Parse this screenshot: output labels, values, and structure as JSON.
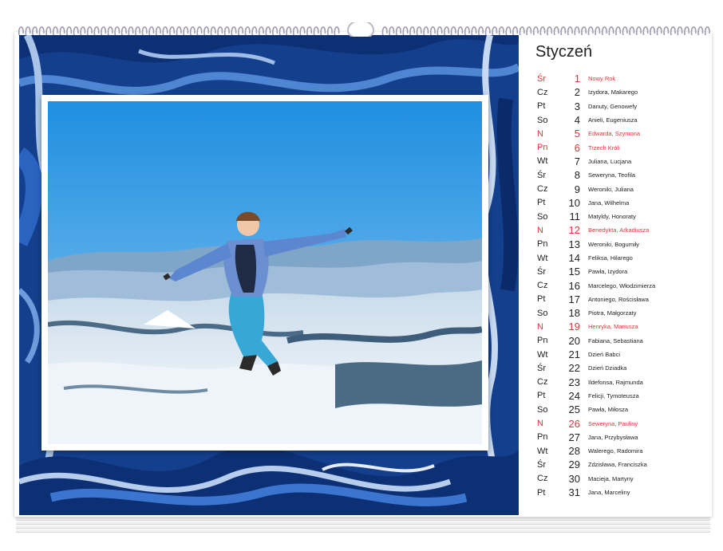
{
  "calendar": {
    "month": "Styczeń",
    "days": [
      {
        "abbr": "Śr",
        "num": "1",
        "names": "Nowy Rok",
        "holiday": true
      },
      {
        "abbr": "Cz",
        "num": "2",
        "names": "Izydora, Makarego",
        "holiday": false
      },
      {
        "abbr": "Pt",
        "num": "3",
        "names": "Danuty, Genowefy",
        "holiday": false
      },
      {
        "abbr": "So",
        "num": "4",
        "names": "Anieli, Eugeniusza",
        "holiday": false
      },
      {
        "abbr": "N",
        "num": "5",
        "names": "Edwarda, Szymona",
        "holiday": true
      },
      {
        "abbr": "Pn",
        "num": "6",
        "names": "Trzech Króli",
        "holiday": true
      },
      {
        "abbr": "Wt",
        "num": "7",
        "names": "Juliana, Lucjana",
        "holiday": false
      },
      {
        "abbr": "Śr",
        "num": "8",
        "names": "Seweryna, Teofila",
        "holiday": false
      },
      {
        "abbr": "Cz",
        "num": "9",
        "names": "Weroniki, Juliana",
        "holiday": false
      },
      {
        "abbr": "Pt",
        "num": "10",
        "names": "Jana, Wilhelma",
        "holiday": false
      },
      {
        "abbr": "So",
        "num": "11",
        "names": "Matyldy, Honoraty",
        "holiday": false
      },
      {
        "abbr": "N",
        "num": "12",
        "names": "Benedykta, Arkadiusza",
        "holiday": true
      },
      {
        "abbr": "Pn",
        "num": "13",
        "names": "Weroniki, Bogumiły",
        "holiday": false
      },
      {
        "abbr": "Wt",
        "num": "14",
        "names": "Feliksa, Hilarego",
        "holiday": false
      },
      {
        "abbr": "Śr",
        "num": "15",
        "names": "Pawła, Izydora",
        "holiday": false
      },
      {
        "abbr": "Cz",
        "num": "16",
        "names": "Marcelego, Włodzimierza",
        "holiday": false
      },
      {
        "abbr": "Pt",
        "num": "17",
        "names": "Antoniego, Rościsława",
        "holiday": false
      },
      {
        "abbr": "So",
        "num": "18",
        "names": "Piotra, Małgorzaty",
        "holiday": false
      },
      {
        "abbr": "N",
        "num": "19",
        "names": "Henryka, Mariusza",
        "holiday": true
      },
      {
        "abbr": "Pn",
        "num": "20",
        "names": "Fabiana, Sebastiana",
        "holiday": false
      },
      {
        "abbr": "Wt",
        "num": "21",
        "names": "Dzień Babci",
        "holiday": false
      },
      {
        "abbr": "Śr",
        "num": "22",
        "names": "Dzień Dziadka",
        "holiday": false
      },
      {
        "abbr": "Cz",
        "num": "23",
        "names": "Ildefonsa, Rajmunda",
        "holiday": false
      },
      {
        "abbr": "Pt",
        "num": "24",
        "names": "Felicji, Tymoteusza",
        "holiday": false
      },
      {
        "abbr": "So",
        "num": "25",
        "names": "Pawła, Miłosza",
        "holiday": false
      },
      {
        "abbr": "N",
        "num": "26",
        "names": "Seweryna, Pauliny",
        "holiday": true
      },
      {
        "abbr": "Pn",
        "num": "27",
        "names": "Jana, Przybysława",
        "holiday": false
      },
      {
        "abbr": "Wt",
        "num": "28",
        "names": "Walerego, Radomira",
        "holiday": false
      },
      {
        "abbr": "Śr",
        "num": "29",
        "names": "Zdzisława, Franciszka",
        "holiday": false
      },
      {
        "abbr": "Cz",
        "num": "30",
        "names": "Macieja, Martyny",
        "holiday": false
      },
      {
        "abbr": "Pt",
        "num": "31",
        "names": "Jana, Marceliny",
        "holiday": false
      }
    ]
  },
  "colors": {
    "holiday": "#e4333c",
    "text": "#222222",
    "marble_dark": "#0d2f73",
    "marble_mid": "#1f57b5",
    "marble_light": "#a9c4e8",
    "sky_top": "#1f8fe0",
    "sky_bottom": "#8ec9f2"
  },
  "icons": {
    "binding": "spiral-wire-binding",
    "hanger": "calendar-hanger-hook"
  }
}
